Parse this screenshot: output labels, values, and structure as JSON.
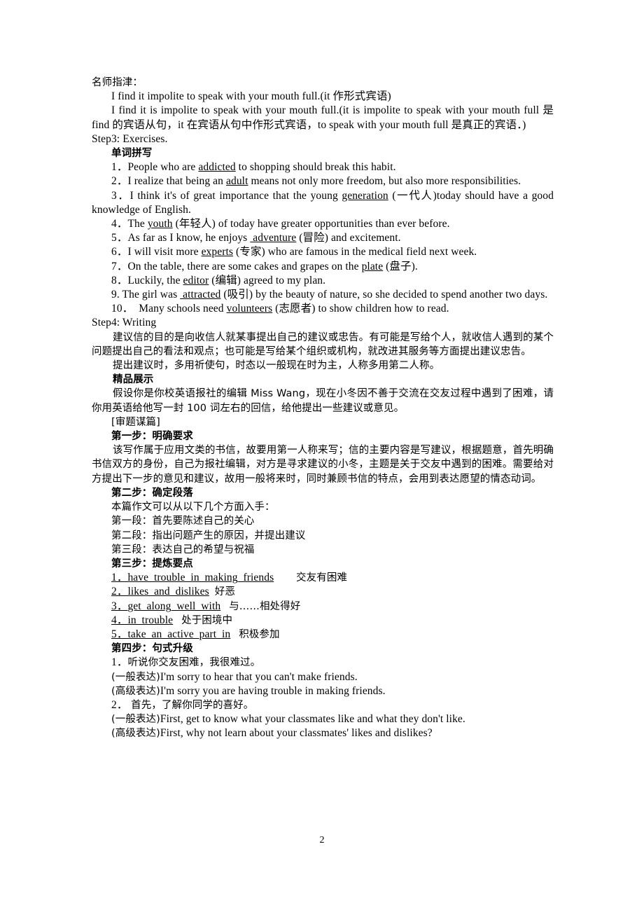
{
  "page": {
    "number": "2"
  },
  "sections": {
    "tip_heading": "名师指津：",
    "tip_line1": "I find it impolite to speak with your mouth full.(it  作形式宾语)",
    "tip_line2": "I find it is impolite to speak with your mouth full.(it is impolite to speak with your mouth full 是 find 的宾语从句，it 在宾语从句中作形式宾语，to speak with your mouth full 是真正的宾语．)",
    "step3_heading": "Step3: Exercises.",
    "spelling_heading": "单词拼写",
    "spelling_items": [
      {
        "num": "1．",
        "pre": "People who are ",
        "answer": "addicted",
        "post": " to shopping should break this habit."
      },
      {
        "num": "2．",
        "pre": "I realize that being an ",
        "answer": "adult",
        "post": " means not only more freedom, but also more responsibilities."
      },
      {
        "num": "3．",
        "pre": "I think it's of great importance that the young ",
        "answer": "generation",
        "post": " (一代人)today should have a good knowledge of English."
      },
      {
        "num": "4．",
        "pre": "The ",
        "answer": "youth",
        "post": " (年轻人) of today have greater opportunities than ever before."
      },
      {
        "num": "5．",
        "pre": "As far as I know, he enjoys ",
        "answer": " adventure",
        "post": " (冒险) and excitement."
      },
      {
        "num": "6．",
        "pre": "I will visit more ",
        "answer": "experts",
        "post": " (专家) who are famous in the medical field next week."
      },
      {
        "num": "7．",
        "pre": "On the table, there are some cakes and grapes on the ",
        "answer": "plate",
        "post": " (盘子)."
      },
      {
        "num": "8．",
        "pre": "Luckily, the ",
        "answer": "editor",
        "post": " (编辑) agreed to my plan."
      },
      {
        "num": "9.",
        "pre": " The girl was ",
        "answer": " attracted",
        "post": " (吸引) by the beauty of nature, so she decided to spend another two days."
      },
      {
        "num": "10．",
        "pre": "  Many schools need ",
        "answer": "volunteers",
        "post": " (志愿者) to show children how to read."
      }
    ],
    "step4_heading": "Step4: Writing",
    "writing_intro_p1": "建议信的目的是向收信人就某事提出自己的建议或忠告。有可能是写给个人，就收信人遇到的某个问题提出自己的看法和观点；也可能是写给某个组织或机构，就改进其服务等方面提出建议忠告。",
    "writing_intro_p2": "提出建议时，多用祈使句，时态以一般现在时为主，人称多用第二人称。",
    "showcase_heading": "精品展示",
    "showcase_prompt": "假设你是你校英语报社的编辑 Miss Wang，现在小冬因不善于交流在交友过程中遇到了困难，请你用英语给他写一封 100 词左右的回信，给他提出一些建议或意见。",
    "analysis_heading": "[审题谋篇]",
    "step_one_heading": "第一步：明确要求",
    "step_one_body": "该写作属于应用文类的书信，故要用第一人称来写；信的主要内容是写建议，根据题意，首先明确书信双方的身份，自己为报社编辑，对方是寻求建议的小冬，主题是关于交友中遇到的困难。需要给对方提出下一步的意见和建议，故用一般将来时，同时兼顾书信的特点，会用到表达愿望的情态动词。",
    "step_two_heading": "第二步：确定段落",
    "step_two_intro": "本篇作文可以从以下几个方面入手：",
    "step_two_items": [
      "第一段：首先要陈述自己的关心",
      "第二段：指出问题产生的原因，并提出建议",
      "第三段：表达自己的希望与祝福"
    ],
    "step_three_heading": "第三步：提炼要点",
    "step_three_items": [
      {
        "num": "1．",
        "phrase": "have_trouble_in_making_friends",
        "gap": "        ",
        "meaning": "交友有困难"
      },
      {
        "num": "2．",
        "phrase": "likes_and_dislikes",
        "gap": "  ",
        "meaning": "好恶"
      },
      {
        "num": "3．",
        "phrase": "get_along_well_with",
        "gap": "   ",
        "meaning": "与……相处得好"
      },
      {
        "num": "4．",
        "phrase": "in_trouble",
        "gap": "   ",
        "meaning": "处于困境中"
      },
      {
        "num": "5．",
        "phrase": "take_an_active_part_in",
        "gap": "   ",
        "meaning": "积极参加"
      }
    ],
    "step_four_heading": "第四步：句式升级",
    "step_four_items": [
      {
        "num": "1．",
        "cn": "听说你交友困难，我很难过。",
        "basic_label": "(一般表达)",
        "basic": "I'm sorry to hear that you can't make friends.",
        "adv_label": "(高级表达)",
        "adv": "I'm sorry you are having trouble in making friends."
      },
      {
        "num": "2．",
        "cn": " 首先，了解你同学的喜好。",
        "basic_label": "(一般表达)",
        "basic": "First, get to know what your classmates like and what they don't like.",
        "adv_label": "(高级表达)",
        "adv": "First, why not learn about your classmates' likes and dislikes?"
      }
    ]
  }
}
